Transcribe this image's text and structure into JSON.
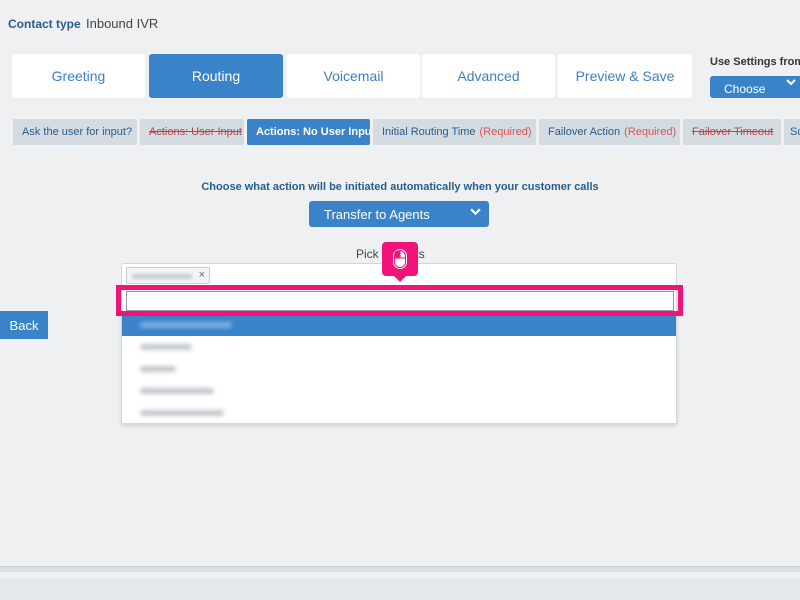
{
  "header": {
    "contact_type_label": "Contact type",
    "contact_type_value": "Inbound IVR"
  },
  "tabs": [
    {
      "label": "Greeting",
      "active": false
    },
    {
      "label": "Routing",
      "active": true
    },
    {
      "label": "Voicemail",
      "active": false
    },
    {
      "label": "Advanced",
      "active": false
    },
    {
      "label": "Preview & Save",
      "active": false
    }
  ],
  "settings": {
    "label": "Use Settings from",
    "select_value": "Choose",
    "icon": "chevron-down-icon"
  },
  "subtabs": [
    {
      "label": "Ask the user for input?",
      "active": false,
      "strike": false,
      "required": ""
    },
    {
      "label": "Actions: User Input",
      "active": false,
      "strike": true,
      "required": ""
    },
    {
      "label": "Actions: No User Input",
      "active": true,
      "strike": false,
      "required": ""
    },
    {
      "label": "Initial Routing Time",
      "active": false,
      "strike": false,
      "required": "(Required)"
    },
    {
      "label": "Failover Action",
      "active": false,
      "strike": false,
      "required": "(Required)"
    },
    {
      "label": "Failover Timeout",
      "active": false,
      "strike": true,
      "required": ""
    },
    {
      "label": "Sc",
      "active": false,
      "strike": false,
      "required": ""
    }
  ],
  "routing": {
    "prompt": "Choose what action will be initiated automatically when your customer calls",
    "action_value": "Transfer to Agents",
    "pick_label": "Pick       ents"
  },
  "multiselect": {
    "chip_remove": "×",
    "search_value": "",
    "options_count_visible": 5,
    "highlighted_option_index": 0
  },
  "annotation": {
    "highlight_color": "#f0147a",
    "cursor_icon": "mouse-icon"
  },
  "back_label": "Back",
  "colors": {
    "accent": "#3a83c9",
    "background": "#eef0f2",
    "title_blue": "#2a5d8c",
    "required_red": "#d9534f"
  }
}
